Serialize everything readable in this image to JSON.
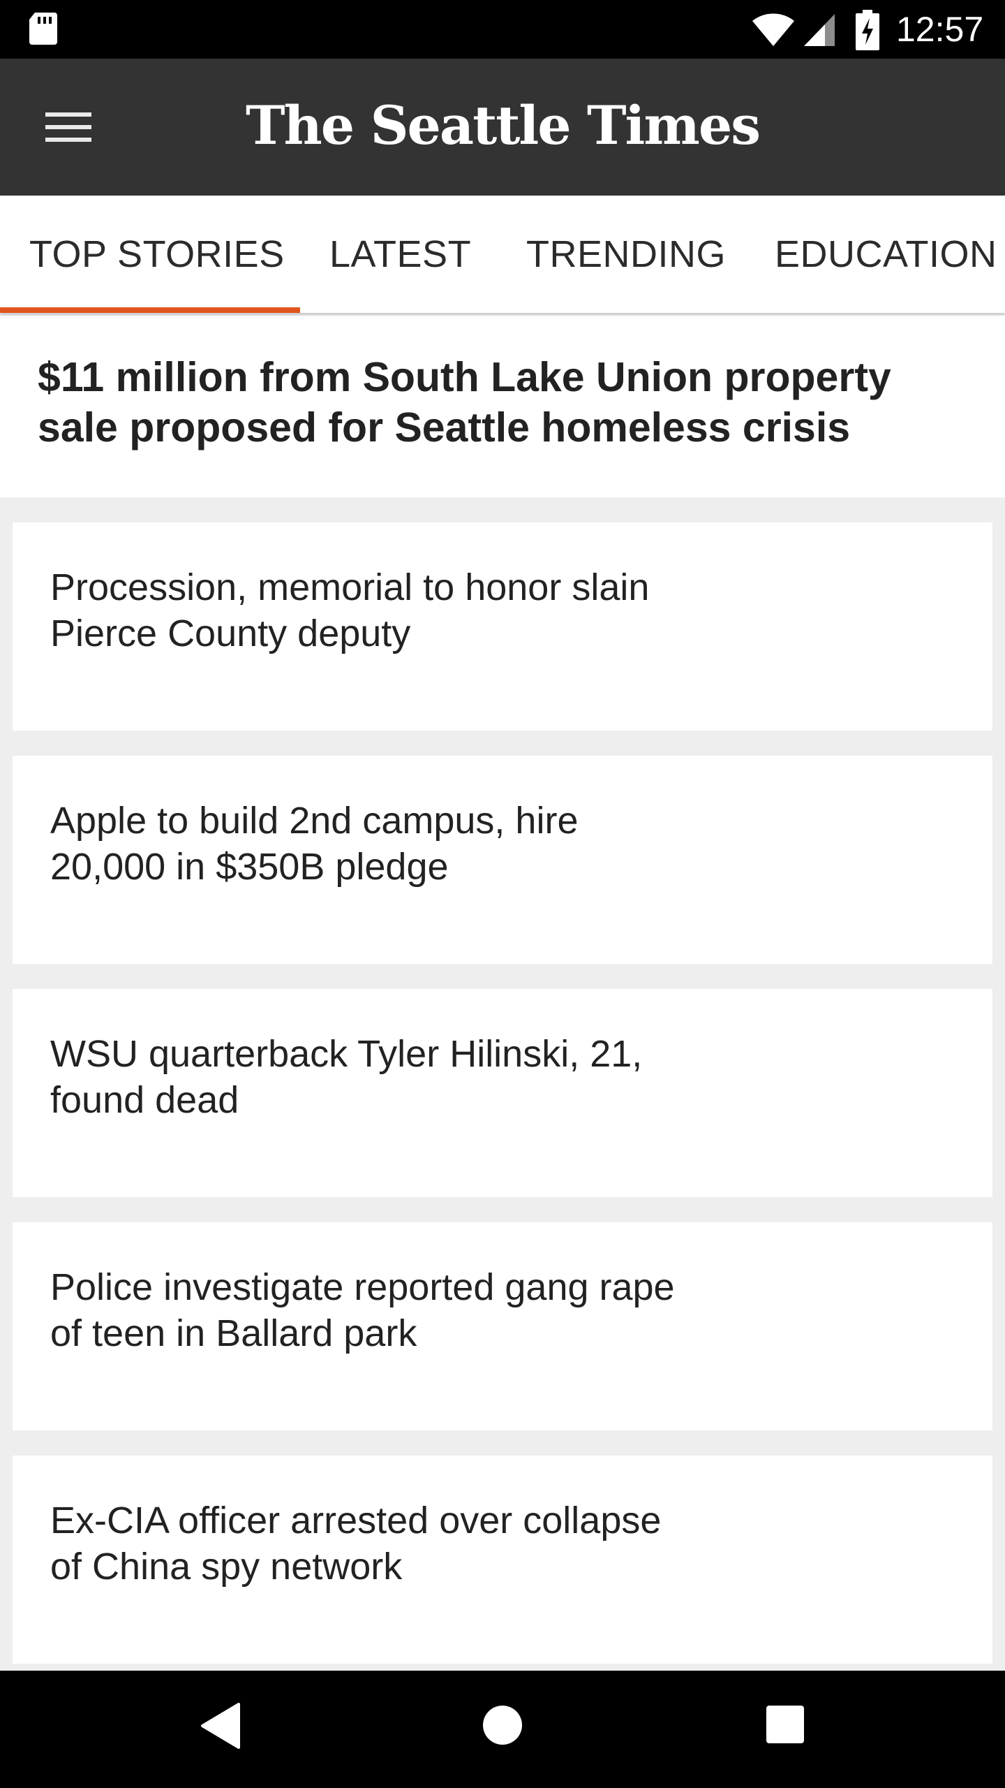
{
  "status_bar": {
    "time": "12:57",
    "icons": [
      "sd-card-icon",
      "wifi-icon",
      "cell-signal-icon",
      "battery-charging-icon"
    ]
  },
  "app_bar": {
    "logo_text": "The Seattle Times",
    "menu_icon": "hamburger-menu-icon"
  },
  "tabs": [
    {
      "label": "TOP STORIES",
      "selected": true
    },
    {
      "label": "LATEST",
      "selected": false
    },
    {
      "label": "TRENDING",
      "selected": false
    },
    {
      "label": "EDUCATION",
      "selected": false
    }
  ],
  "colors": {
    "app_bar": "#333333",
    "tab_indicator": "#e0561d",
    "background": "#eeeeee"
  },
  "lead_story": {
    "headline_line1": "$11 million from South Lake Union property",
    "headline_line2": "sale proposed for Seattle homeless crisis"
  },
  "stories": [
    {
      "line1": "Procession, memorial to honor slain",
      "line2": "Pierce County deputy"
    },
    {
      "line1": "Apple to build 2nd campus, hire",
      "line2": "20,000 in $350B pledge"
    },
    {
      "line1": "WSU quarterback Tyler Hilinski, 21,",
      "line2": "found dead"
    },
    {
      "line1": "Police investigate reported gang rape",
      "line2": "of teen in Ballard park"
    },
    {
      "line1": "Ex-CIA officer arrested over collapse",
      "line2": "of China spy network"
    }
  ],
  "nav_bar": {
    "icons": [
      "back-icon",
      "home-icon",
      "recents-icon"
    ]
  }
}
